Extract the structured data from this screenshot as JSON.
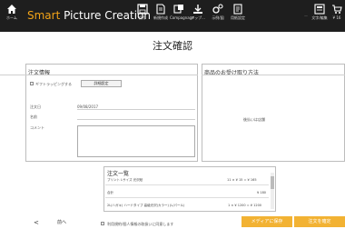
{
  "header": {
    "home_label": "ホーム",
    "brand_accent": "Smart",
    "brand_rest": " Picture Creation",
    "tools": [
      {
        "icon": "save-icon",
        "label": "保存"
      },
      {
        "icon": "document-icon",
        "label": "新規作成"
      },
      {
        "icon": "layout-icon",
        "label": "Compagnage"
      },
      {
        "icon": "upload-icon",
        "label": "アップ..."
      },
      {
        "icon": "settings-icon",
        "label": "示例/図"
      },
      {
        "icon": "book-icon",
        "label": "用紙設定"
      }
    ],
    "right_dim": "—",
    "right_tools": [
      {
        "icon": "doc-preview-icon",
        "label": "文字/編集"
      },
      {
        "icon": "cart-icon",
        "label": "¥ 16"
      }
    ],
    "colors": {
      "bar": "#1e1e1e",
      "accent": "#f2a318"
    }
  },
  "page": {
    "title": "注文確認"
  },
  "order_info": {
    "heading": "注文情報",
    "checkbox_label": "ギフトラッピングする",
    "detail_button": "詳細設定",
    "fields": [
      {
        "label": "注文日",
        "value": "09/08/2017"
      },
      {
        "label": "名前",
        "value": ""
      },
      {
        "label": "コメント",
        "value": ""
      }
    ]
  },
  "pickup": {
    "heading": "商品のお受け取り方法",
    "message": "後払いは店舗"
  },
  "order_list": {
    "title": "注文一覧",
    "items": [
      {
        "name": "プリント Lサイズ 光沢紙",
        "price": "11 × ¥ 15 = ¥ 165"
      },
      {
        "name": "合計",
        "price": "¥ 180"
      },
      {
        "name": "2L(ハガキ) ハードタイプ 高級光沢(カラー) (L/パール)",
        "price": "1 × ¥ 1200 = ¥ 1200"
      }
    ]
  },
  "footer": {
    "back_label": "前へ",
    "checkbox_label": "利用規約/個人情報の取扱いに同意します",
    "save_label": "メディアに保存",
    "confirm_label": "注文を確定"
  }
}
